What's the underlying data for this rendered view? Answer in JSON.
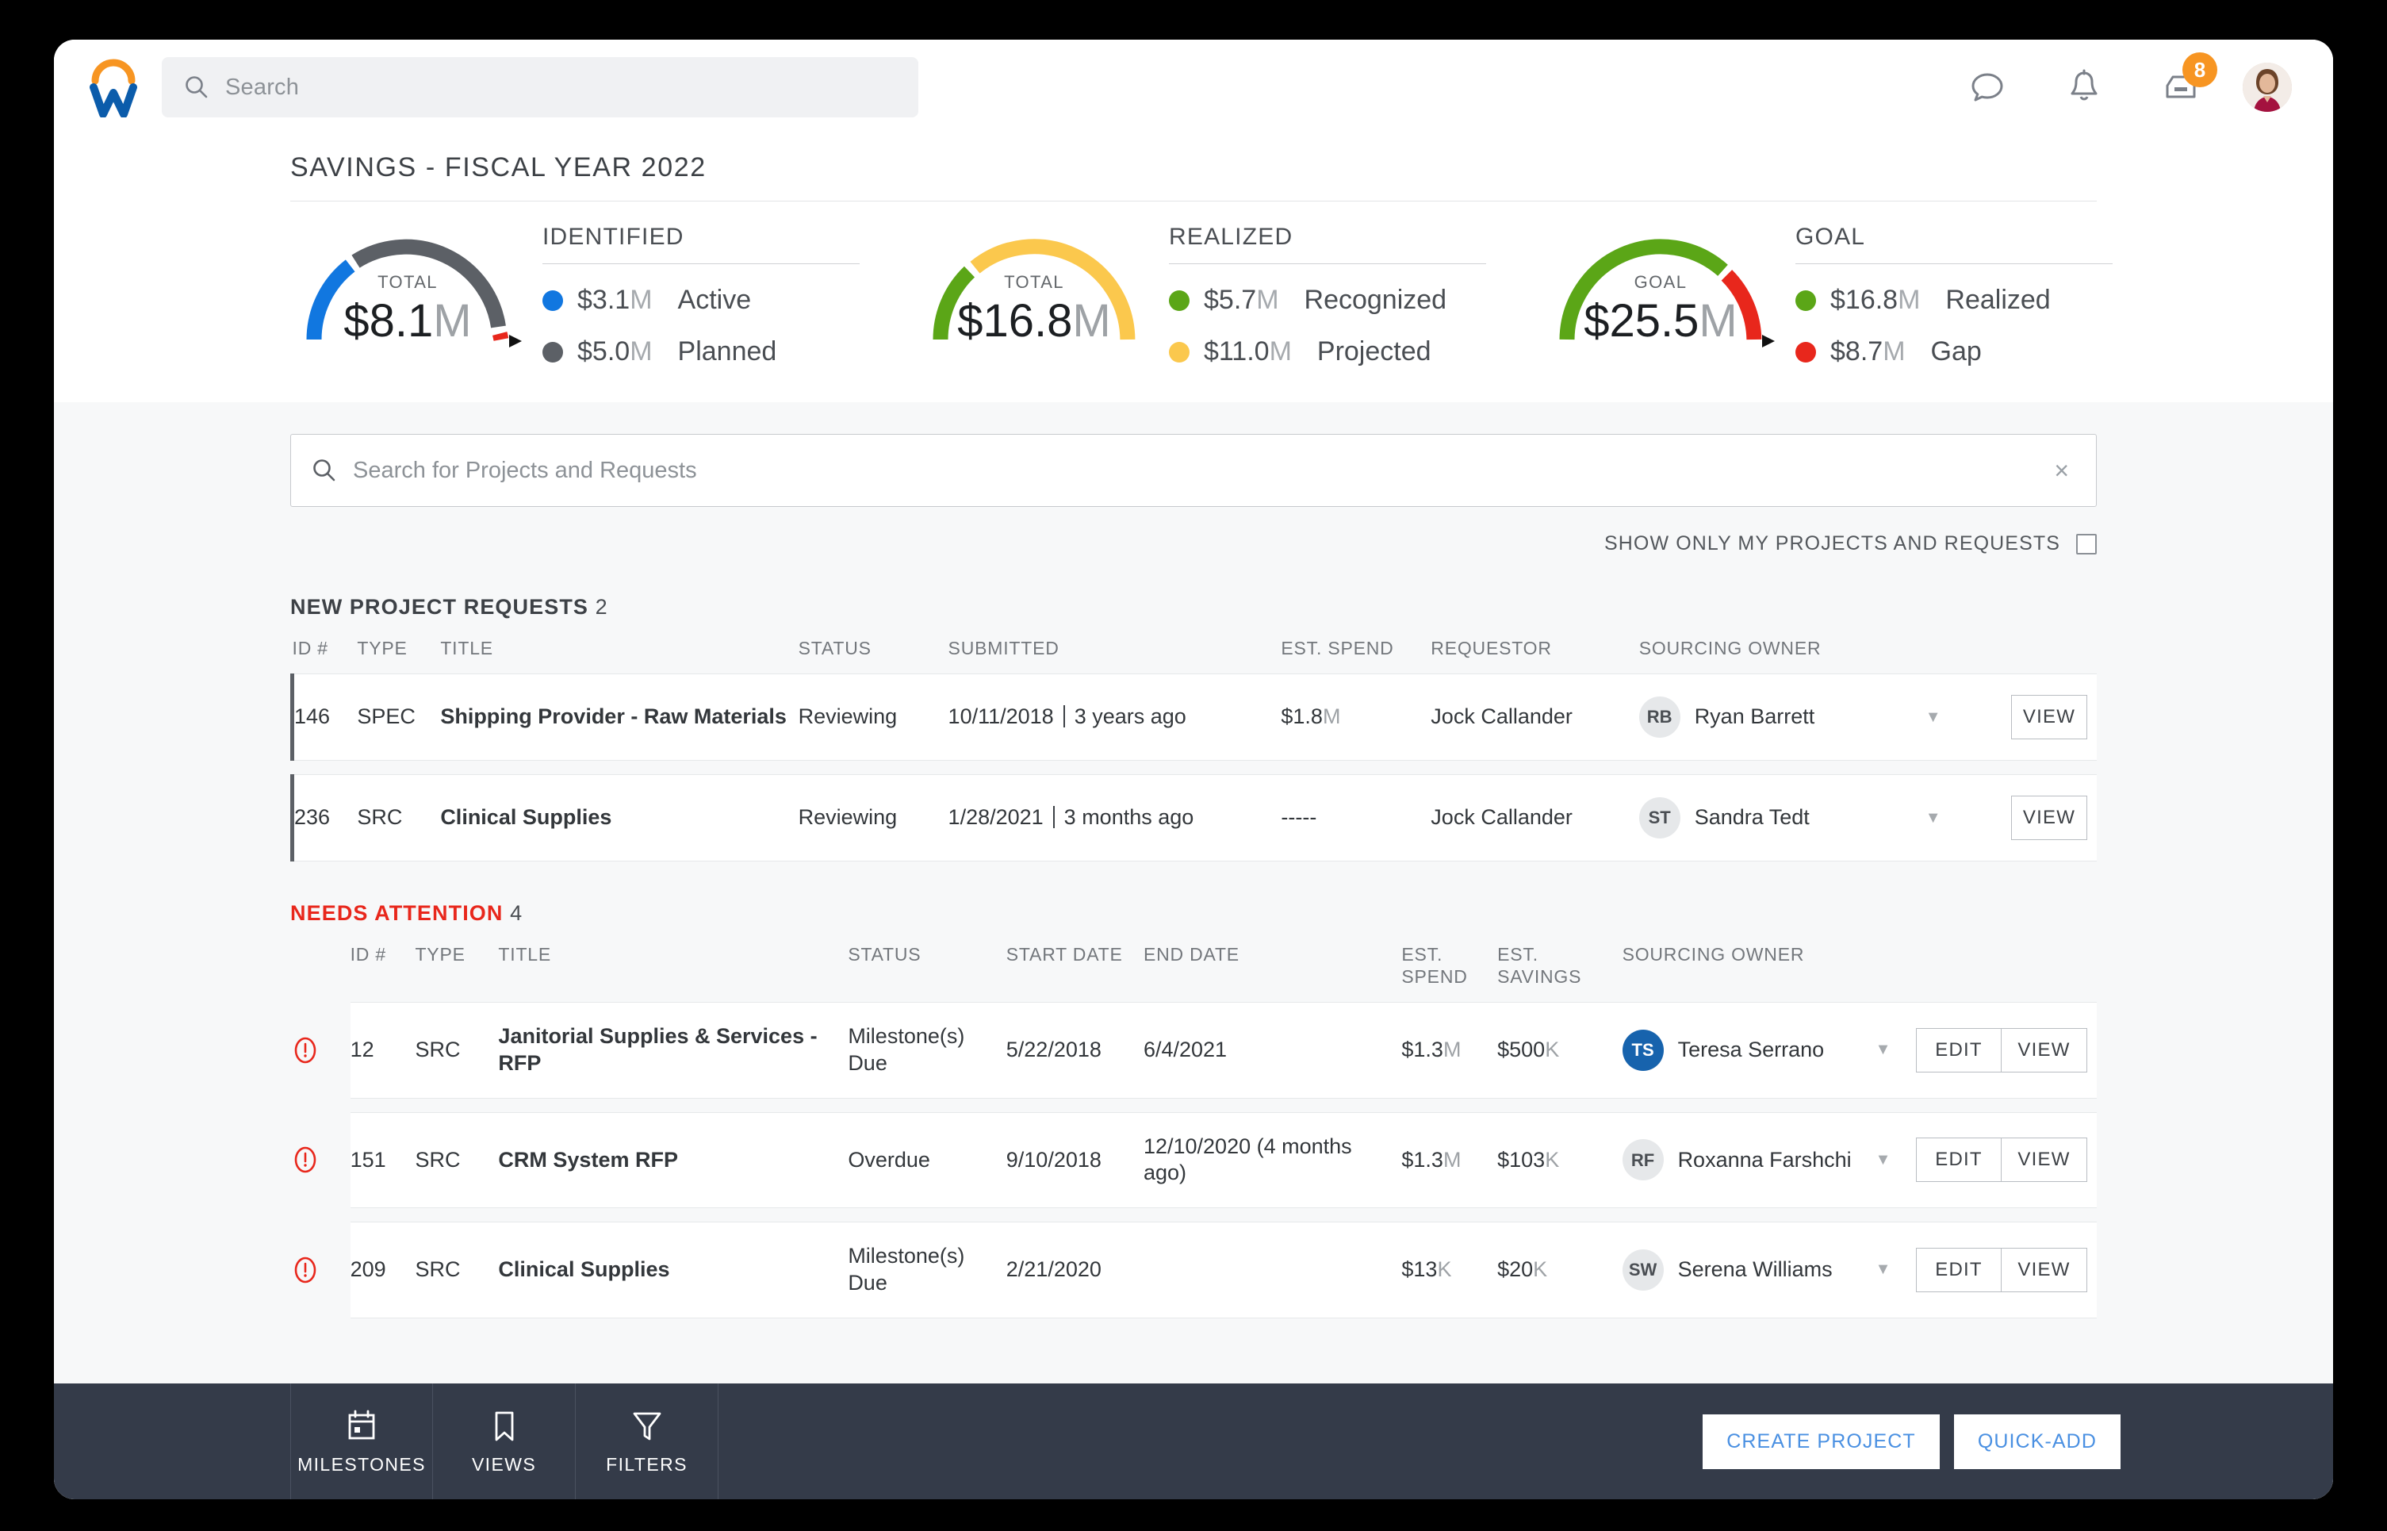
{
  "topbar": {
    "logo_name": "workday-logo",
    "search_placeholder": "Search",
    "icons": [
      {
        "name": "chat-icon"
      },
      {
        "name": "bell-icon"
      },
      {
        "name": "inbox-icon",
        "badge": "8"
      }
    ]
  },
  "savings": {
    "title": "SAVINGS - FISCAL YEAR 2022",
    "gauges": [
      {
        "center_label": "TOTAL",
        "center_value": "$8.1",
        "center_suffix": "M",
        "legend_title": "IDENTIFIED",
        "legend": [
          {
            "color": "#1177e0",
            "amount": "$3.1",
            "suffix": "M",
            "name": "Active"
          },
          {
            "color": "#5c6066",
            "amount": "$5.0",
            "suffix": "M",
            "name": "Planned"
          }
        ]
      },
      {
        "center_label": "TOTAL",
        "center_value": "$16.8",
        "center_suffix": "M",
        "legend_title": "REALIZED",
        "legend": [
          {
            "color": "#5ba617",
            "amount": "$5.7",
            "suffix": "M",
            "name": "Recognized"
          },
          {
            "color": "#fbc84d",
            "amount": "$11.0",
            "suffix": "M",
            "name": "Projected"
          }
        ]
      },
      {
        "center_label": "GOAL",
        "center_value": "$25.5",
        "center_suffix": "M",
        "legend_title": "GOAL",
        "legend": [
          {
            "color": "#5ba617",
            "amount": "$16.8",
            "suffix": "M",
            "name": "Realized"
          },
          {
            "color": "#e8271c",
            "amount": "$8.7",
            "suffix": "M",
            "name": "Gap"
          }
        ]
      }
    ]
  },
  "chart_data": [
    {
      "type": "pie",
      "title": "IDENTIFIED",
      "center_total": 8.1,
      "unit": "$M",
      "labels": [
        "Active",
        "Planned"
      ],
      "values": [
        3.1,
        5.0
      ],
      "colors": [
        "#1177e0",
        "#5c6066"
      ],
      "needle_marker": true,
      "marker_color": "#e8271c"
    },
    {
      "type": "pie",
      "title": "REALIZED",
      "center_total": 16.8,
      "unit": "$M",
      "labels": [
        "Recognized",
        "Projected"
      ],
      "values": [
        5.7,
        11.0
      ],
      "colors": [
        "#5ba617",
        "#fbc84d"
      ],
      "needle_marker": false
    },
    {
      "type": "pie",
      "title": "GOAL",
      "center_total": 25.5,
      "unit": "$M",
      "labels": [
        "Realized",
        "Gap"
      ],
      "values": [
        16.8,
        8.7
      ],
      "colors": [
        "#5ba617",
        "#e8271c"
      ],
      "needle_marker": true,
      "marker_color": "#000000"
    }
  ],
  "search": {
    "placeholder": "Search for Projects and Requests",
    "clear_label": "×"
  },
  "filter": {
    "only_mine_label": "SHOW ONLY MY PROJECTS AND REQUESTS",
    "only_mine_checked": false
  },
  "new_requests": {
    "heading": "NEW PROJECT REQUESTS",
    "count": "2",
    "columns": [
      "ID #",
      "TYPE",
      "TITLE",
      "STATUS",
      "SUBMITTED",
      "EST. SPEND",
      "REQUESTOR",
      "SOURCING OWNER"
    ],
    "rows": [
      {
        "id": "146",
        "type": "SPEC",
        "title": "Shipping Provider - Raw Materials",
        "status": "Reviewing",
        "submitted_date": "10/11/2018",
        "submitted_rel": "3 years ago",
        "est_spend": "$1.8",
        "est_spend_suffix": "M",
        "requestor": "Jock Callander",
        "owner_initials": "RB",
        "owner_name": "Ryan Barrett",
        "owner_blue": false,
        "view_label": "VIEW"
      },
      {
        "id": "236",
        "type": "SRC",
        "title": "Clinical Supplies",
        "status": "Reviewing",
        "submitted_date": "1/28/2021",
        "submitted_rel": "3 months ago",
        "est_spend": "-----",
        "est_spend_suffix": "",
        "requestor": "Jock Callander",
        "owner_initials": "ST",
        "owner_name": "Sandra Tedt",
        "owner_blue": false,
        "view_label": "VIEW"
      }
    ]
  },
  "needs_attention": {
    "heading": "NEEDS ATTENTION",
    "count": "4",
    "columns": [
      "ID #",
      "TYPE",
      "TITLE",
      "STATUS",
      "START DATE",
      "END DATE",
      "EST. SPEND",
      "EST. SAVINGS",
      "SOURCING OWNER"
    ],
    "rows": [
      {
        "id": "12",
        "type": "SRC",
        "title": "Janitorial Supplies & Services - RFP",
        "status": "Milestone(s) Due",
        "status_red": true,
        "start_date": "5/22/2018",
        "end_date": "6/4/2021",
        "end_date_red": false,
        "est_spend": "$1.3",
        "est_spend_suffix": "M",
        "est_savings": "$500",
        "est_savings_suffix": "K",
        "owner_initials": "TS",
        "owner_name": "Teresa Serrano",
        "owner_blue": true,
        "edit_label": "EDIT",
        "view_label": "VIEW"
      },
      {
        "id": "151",
        "type": "SRC",
        "title": "CRM System RFP",
        "status": "Overdue",
        "status_red": false,
        "start_date": "9/10/2018",
        "end_date": "12/10/2020 (4 months ago)",
        "end_date_red": true,
        "est_spend": "$1.3",
        "est_spend_suffix": "M",
        "est_savings": "$103",
        "est_savings_suffix": "K",
        "owner_initials": "RF",
        "owner_name": "Roxanna Farshchi",
        "owner_blue": false,
        "edit_label": "EDIT",
        "view_label": "VIEW"
      },
      {
        "id": "209",
        "type": "SRC",
        "title": "Clinical Supplies",
        "status": "Milestone(s) Due",
        "status_red": true,
        "start_date": "2/21/2020",
        "end_date": "",
        "end_date_red": false,
        "est_spend": "$13",
        "est_spend_suffix": "K",
        "est_savings": "$20",
        "est_savings_suffix": "K",
        "owner_initials": "SW",
        "owner_name": "Serena Williams",
        "owner_blue": false,
        "edit_label": "EDIT",
        "view_label": "VIEW"
      }
    ]
  },
  "bottombar": {
    "items": [
      {
        "icon": "calendar-icon",
        "label": "MILESTONES"
      },
      {
        "icon": "bookmark-icon",
        "label": "VIEWS"
      },
      {
        "icon": "funnel-icon",
        "label": "FILTERS"
      }
    ],
    "create_project_label": "CREATE PROJECT",
    "quick_add_label": "QUICK-ADD"
  }
}
